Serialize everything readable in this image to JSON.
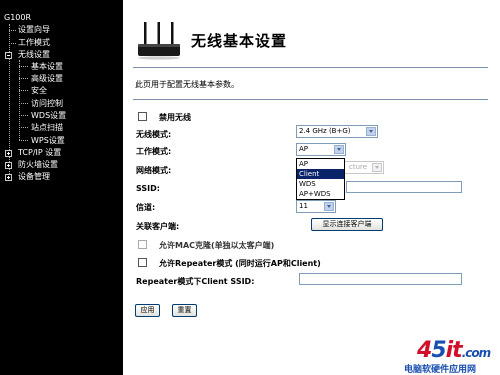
{
  "sidebar": {
    "root": "G100R",
    "items": [
      {
        "label": "设置向导"
      },
      {
        "label": "工作模式"
      },
      {
        "label": "无线设置"
      },
      {
        "label": "基本设置"
      },
      {
        "label": "高级设置"
      },
      {
        "label": "安全"
      },
      {
        "label": "访问控制"
      },
      {
        "label": "WDS设置"
      },
      {
        "label": "站点扫描"
      },
      {
        "label": "WPS设置"
      },
      {
        "label": "TCP/IP 设置"
      },
      {
        "label": "防火墙设置"
      },
      {
        "label": "设备管理"
      }
    ]
  },
  "page": {
    "title": "无线基本设置",
    "description": "此页用于配置无线基本参数。"
  },
  "form": {
    "disable_wireless": {
      "label": "禁用无线",
      "checked": false
    },
    "band": {
      "label": "无线模式:",
      "value": "2.4 GHz (B+G)"
    },
    "mode": {
      "label": "工作模式:",
      "value": "AP",
      "options": [
        "AP",
        "Client",
        "WDS",
        "AP+WDS"
      ],
      "highlighted": "Client"
    },
    "network_type": {
      "label": "网络模式:",
      "value": "cture"
    },
    "ssid": {
      "label": "SSID:",
      "value": ""
    },
    "channel": {
      "label": "信道:",
      "value": "11"
    },
    "clients": {
      "label": "关联客户端:",
      "button": "显示连接客户端"
    },
    "mac_clone": {
      "label": "允许MAC克隆(单独以太客户端)",
      "checked": false
    },
    "repeater": {
      "label": "允许Repeater模式 (同时运行AP和Client)",
      "checked": false
    },
    "repeater_ssid": {
      "label": "Repeater模式下Client SSID:",
      "value": ""
    }
  },
  "buttons": {
    "apply": "应用",
    "reset": "重置"
  },
  "watermark": {
    "logo_a": "4",
    "logo_b": "5",
    "logo_c": "it",
    "logo_d": ".com",
    "tagline": "电脑软硬件应用网"
  }
}
